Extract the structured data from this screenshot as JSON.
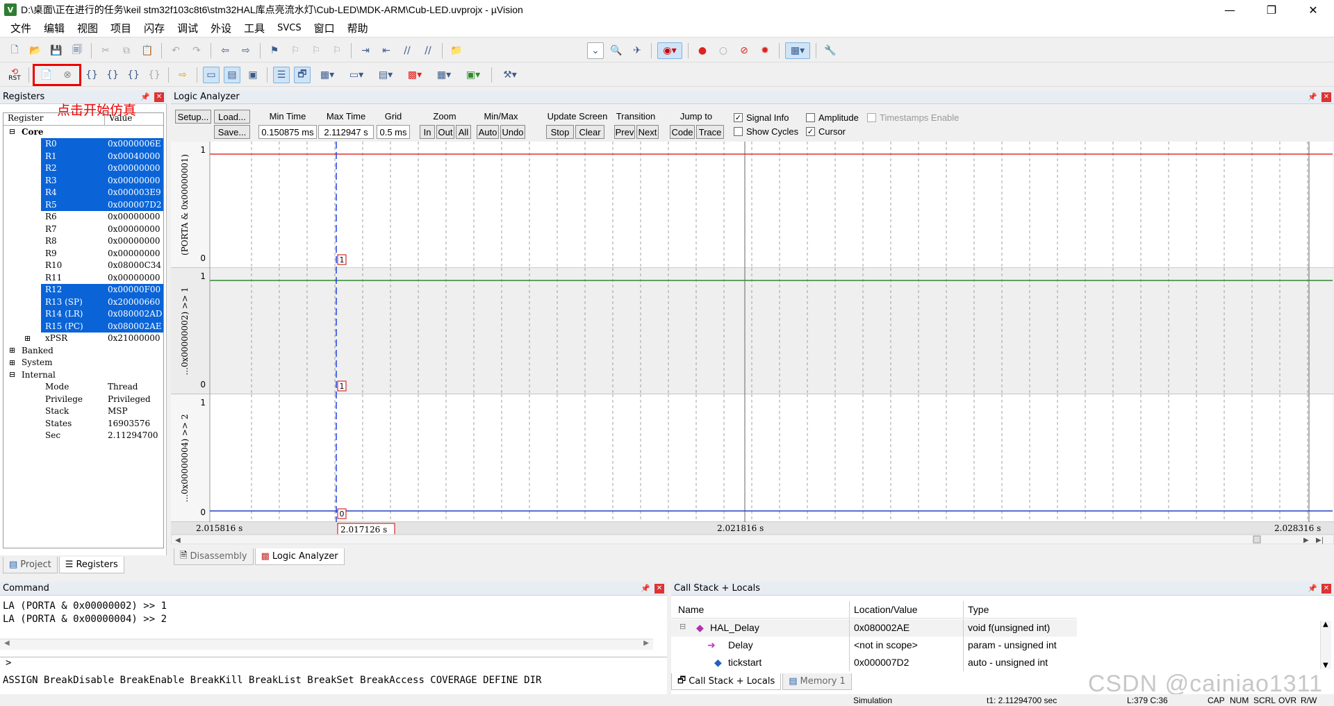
{
  "window": {
    "title": "D:\\桌面\\正在进行的任务\\keil stm32f103c8t6\\stm32HAL库点亮流水灯\\Cub-LED\\MDK-ARM\\Cub-LED.uvprojx - µVision",
    "icon": "V"
  },
  "menu": [
    "文件",
    "编辑",
    "视图",
    "项目",
    "闪存",
    "调试",
    "外设",
    "工具",
    "SVCS",
    "窗口",
    "帮助"
  ],
  "toolbar2": {
    "rst_label": "RST"
  },
  "annotation": "点击开始仿真",
  "registers": {
    "title": "Registers",
    "col_register": "Register",
    "col_value": "Value",
    "core_label": "Core",
    "rows": [
      {
        "name": "R0",
        "value": "0x0000006E",
        "sel": true
      },
      {
        "name": "R1",
        "value": "0x00040000",
        "sel": true
      },
      {
        "name": "R2",
        "value": "0x00000000",
        "sel": true
      },
      {
        "name": "R3",
        "value": "0x00000000",
        "sel": true
      },
      {
        "name": "R4",
        "value": "0x000003E9",
        "sel": true
      },
      {
        "name": "R5",
        "value": "0x000007D2",
        "sel": true
      },
      {
        "name": "R6",
        "value": "0x00000000",
        "sel": false
      },
      {
        "name": "R7",
        "value": "0x00000000",
        "sel": false
      },
      {
        "name": "R8",
        "value": "0x00000000",
        "sel": false
      },
      {
        "name": "R9",
        "value": "0x00000000",
        "sel": false
      },
      {
        "name": "R10",
        "value": "0x08000C34",
        "sel": false
      },
      {
        "name": "R11",
        "value": "0x00000000",
        "sel": false
      },
      {
        "name": "R12",
        "value": "0x00000F00",
        "sel": true
      },
      {
        "name": "R13 (SP)",
        "value": "0x20000660",
        "sel": true
      },
      {
        "name": "R14 (LR)",
        "value": "0x080002AD",
        "sel": true
      },
      {
        "name": "R15 (PC)",
        "value": "0x080002AE",
        "sel": true
      },
      {
        "name": "xPSR",
        "value": "0x21000000",
        "sel": false
      }
    ],
    "groups": [
      "Banked",
      "System",
      "Internal"
    ],
    "internal": [
      {
        "name": "Mode",
        "value": "Thread"
      },
      {
        "name": "Privilege",
        "value": "Privileged"
      },
      {
        "name": "Stack",
        "value": "MSP"
      },
      {
        "name": "States",
        "value": "16903576"
      },
      {
        "name": "Sec",
        "value": "2.11294700"
      }
    ]
  },
  "left_tabs": [
    "Project",
    "Registers"
  ],
  "logic_analyzer": {
    "title": "Logic Analyzer",
    "setup": "Setup...",
    "load": "Load...",
    "save": "Save...",
    "min_time_label": "Min Time",
    "min_time": "0.150875 ms",
    "max_time_label": "Max Time",
    "max_time": "2.112947 s",
    "grid_label": "Grid",
    "grid": "0.5 ms",
    "zoom_label": "Zoom",
    "zoom_in": "In",
    "zoom_out": "Out",
    "zoom_all": "All",
    "minmax_label": "Min/Max",
    "minmax_auto": "Auto",
    "minmax_undo": "Undo",
    "update_label": "Update Screen",
    "update_stop": "Stop",
    "update_clear": "Clear",
    "transition_label": "Transition",
    "trans_prev": "Prev",
    "trans_next": "Next",
    "jump_label": "Jump to",
    "jump_code": "Code",
    "jump_trace": "Trace",
    "signal_info": "Signal Info",
    "amplitude": "Amplitude",
    "timestamps": "Timestamps Enable",
    "show_cycles": "Show Cycles",
    "cursor": "Cursor",
    "signals": [
      {
        "label": "(PORTA & 0x00000001)",
        "hi": "1",
        "lo": "0",
        "marker": "1",
        "level": 1,
        "color": "#e03030"
      },
      {
        "label": "...0x00000002) >> 1",
        "hi": "1",
        "lo": "0",
        "marker": "1",
        "level": 1,
        "color": "#2e8b2e"
      },
      {
        "label": "...0x00000004) >> 2",
        "hi": "1",
        "lo": "0",
        "marker": "0",
        "level": 0,
        "color": "#2040c0"
      }
    ],
    "time_start": "2.015816 s",
    "time_cursor": "2.017126 s",
    "time_mid": "2.021816 s",
    "time_end": "2.028316 s"
  },
  "center_tabs": [
    "Disassembly",
    "Logic Analyzer"
  ],
  "command": {
    "title": "Command",
    "lines": [
      "LA (PORTA & 0x00000002) >> 1",
      "LA (PORTA & 0x00000004) >> 2"
    ],
    "prompt": ">",
    "hint": "ASSIGN BreakDisable BreakEnable BreakKill BreakList BreakSet BreakAccess COVERAGE DEFINE DIR"
  },
  "callstack": {
    "title": "Call Stack + Locals",
    "col_name": "Name",
    "col_loc": "Location/Value",
    "col_type": "Type",
    "rows": [
      {
        "name": "HAL_Delay",
        "loc": "0x080002AE",
        "type": "void f(unsigned int)"
      },
      {
        "name": "Delay",
        "loc": "<not in scope>",
        "type": "param - unsigned int"
      },
      {
        "name": "tickstart",
        "loc": "0x000007D2",
        "type": "auto - unsigned int"
      }
    ],
    "tabs": [
      "Call Stack + Locals",
      "Memory 1"
    ]
  },
  "status": {
    "mode": "Simulation",
    "time": "t1: 2.11294700 sec",
    "pos": "L:379 C:36",
    "cap": "CAP",
    "num": "NUM",
    "scrl": "SCRL",
    "ovr": "OVR",
    "rw": "R/W"
  },
  "watermark": "CSDN @cainiao1311"
}
